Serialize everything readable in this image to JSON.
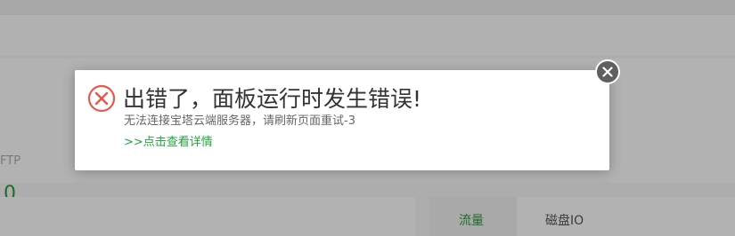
{
  "background": {
    "stats": {
      "ftp_label": "FTP",
      "ftp_value": "0"
    },
    "tabs": [
      {
        "label": "流量",
        "active": true
      },
      {
        "label": "磁盘IO",
        "active": false
      }
    ]
  },
  "dialog": {
    "icon": "error-x-circle-icon",
    "title": "出错了，面板运行时发生错误!",
    "message": "无法连接宝塔云端服务器，请刷新页面重试-3",
    "link_label": ">>点击查看详情",
    "close_icon": "close-icon"
  },
  "colors": {
    "error_red": "#e8584f",
    "link_green": "#20a53a",
    "overlay": "#adadad",
    "close_bg": "#5f5f5f"
  }
}
